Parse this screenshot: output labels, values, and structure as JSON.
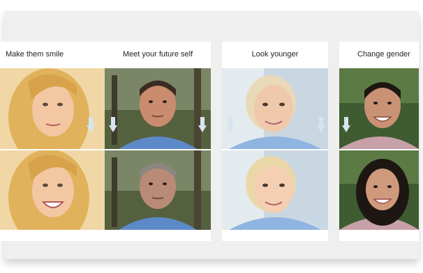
{
  "cards": [
    {
      "label": "Make them smile",
      "top_photo": "blonde-woman-neutral",
      "bottom_photo": "blonde-woman-smiling"
    },
    {
      "label": "Meet your future self",
      "top_photo": "man-current",
      "bottom_photo": "man-aged"
    },
    {
      "label": "Look younger",
      "top_photo": "older-woman",
      "bottom_photo": "older-woman-younger"
    },
    {
      "label": "Change gender",
      "top_photo": "young-man",
      "bottom_photo": "young-woman"
    }
  ],
  "arrow_icon": "down-arrow-icon",
  "colors": {
    "frame_bg": "#efefef",
    "card_bg": "#ffffff",
    "arrow": "#d6e4ef"
  }
}
